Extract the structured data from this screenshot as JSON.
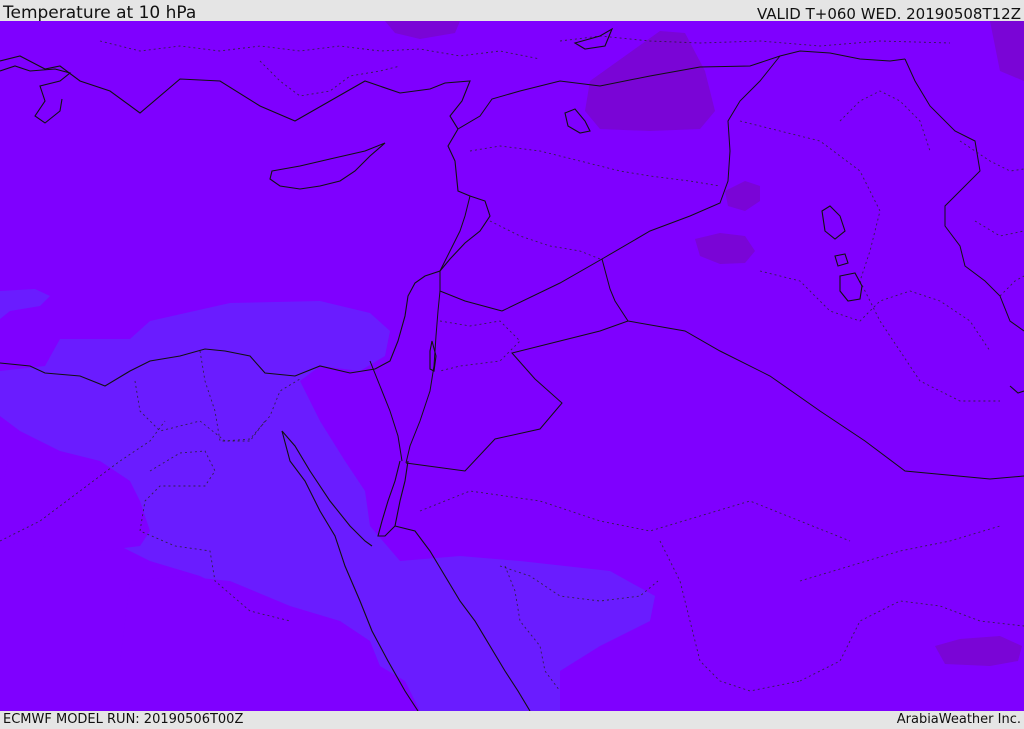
{
  "header": {
    "title": "Temperature at 10 hPa",
    "valid": "VALID T+060 WED. 20190508T12Z"
  },
  "footer": {
    "model_run": "ECMWF MODEL RUN: 20190506T00Z",
    "credit": "ArabiaWeather Inc."
  },
  "map": {
    "field": "temperature",
    "level": "10 hPa",
    "colors": {
      "base_violet": "#7f00ff",
      "cooler_blue_violet": "#6a1cff",
      "warmer_purple": "#7a05d6",
      "coastline": "#111111"
    }
  }
}
